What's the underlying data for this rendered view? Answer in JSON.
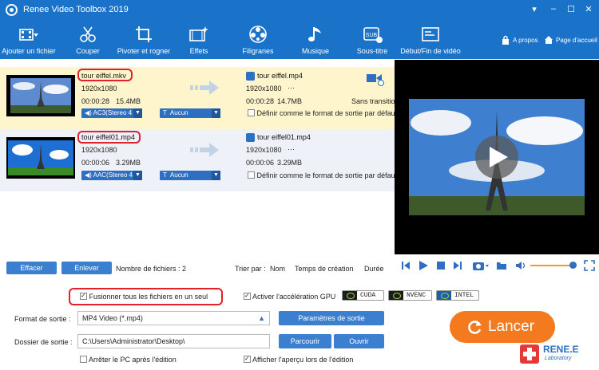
{
  "window": {
    "title": "Renee Video Toolbox 2019",
    "min_label": "–",
    "max_label": "☐",
    "close_label": "✕",
    "menu_label": "▾"
  },
  "toolbar": {
    "items": [
      {
        "label": "Ajouter un fichier",
        "icon": "add-file-icon"
      },
      {
        "label": "Couper",
        "icon": "scissors-icon"
      },
      {
        "label": "Pivoter et rogner",
        "icon": "crop-rotate-icon"
      },
      {
        "label": "Effets",
        "icon": "effects-icon"
      },
      {
        "label": "Filigranes",
        "icon": "watermark-icon"
      },
      {
        "label": "Musique",
        "icon": "music-note-icon"
      },
      {
        "label": "Sous-titre",
        "icon": "subtitle-icon"
      },
      {
        "label": "Début/Fin de vidéo",
        "icon": "intro-outro-icon"
      }
    ],
    "about_label": "A propos",
    "home_label": "Page d'accueil"
  },
  "files": [
    {
      "name": "tour eiffel.mkv",
      "resolution": "1920x1080",
      "duration": "00:00:28",
      "size": "15.4MB",
      "audio": "AC3(Stereo 4",
      "subtitle": "Aucun",
      "out_name": "tour eiffel.mp4",
      "out_resolution": "1920x1080",
      "out_more": "···",
      "out_duration": "00:00:28",
      "out_size": "14.7MB",
      "transition": "Sans transitio",
      "default_format_label": "Définir comme le format de sortie par défaut",
      "thumb_sky": "#5d8bd0"
    },
    {
      "name": "tour eiffel01.mp4",
      "resolution": "1920x1080",
      "duration": "00:00:06",
      "size": "3.29MB",
      "audio": "AAC(Stereo 4",
      "subtitle": "Aucun",
      "out_name": "tour eiffel01.mp4",
      "out_resolution": "1920x1080",
      "out_more": "···",
      "out_duration": "00:00:06",
      "out_size": "3.29MB",
      "default_format_label": "Définir comme le format de sortie par défaut",
      "thumb_sky": "#1e6fd3"
    }
  ],
  "list_bar": {
    "clear_label": "Effacer",
    "remove_label": "Enlever",
    "count_text": "Nombre de fichiers : 2",
    "sort_label": "Trier par :",
    "sort_name": "Nom",
    "sort_created": "Temps de création",
    "sort_duration": "Durée"
  },
  "player": {
    "volume": 0.92
  },
  "options": {
    "merge_label": "Fusionner tous les fichiers en un seul",
    "merge_checked": true,
    "gpu_label": "Activer l'accélération GPU",
    "gpu_checked": true,
    "gpu_cuda": "CUDA",
    "gpu_nvenc": "NVENC",
    "gpu_intel": "INTEL",
    "format_label": "Format de sortie :",
    "format_value": "MP4 Video (*.mp4)",
    "format_settings_label": "Paramètres de sortie",
    "folder_label": "Dossier de sortie :",
    "folder_value": "C:\\Users\\Administrator\\Desktop\\",
    "browse_label": "Parcourir",
    "open_label": "Ouvrir",
    "shutdown_label": "Arrêter le PC après l'édition",
    "shutdown_checked": false,
    "preview_label": "Afficher l'aperçu lors de l'édition",
    "preview_checked": true,
    "launch_label": "Lancer"
  },
  "brand": {
    "name": "RENE.E",
    "sub": "Laboratory"
  },
  "colors": {
    "accent": "#1a73c9",
    "launch": "#f47a1f",
    "highlight": "#e0222c",
    "selected_row": "#fff5cc"
  }
}
